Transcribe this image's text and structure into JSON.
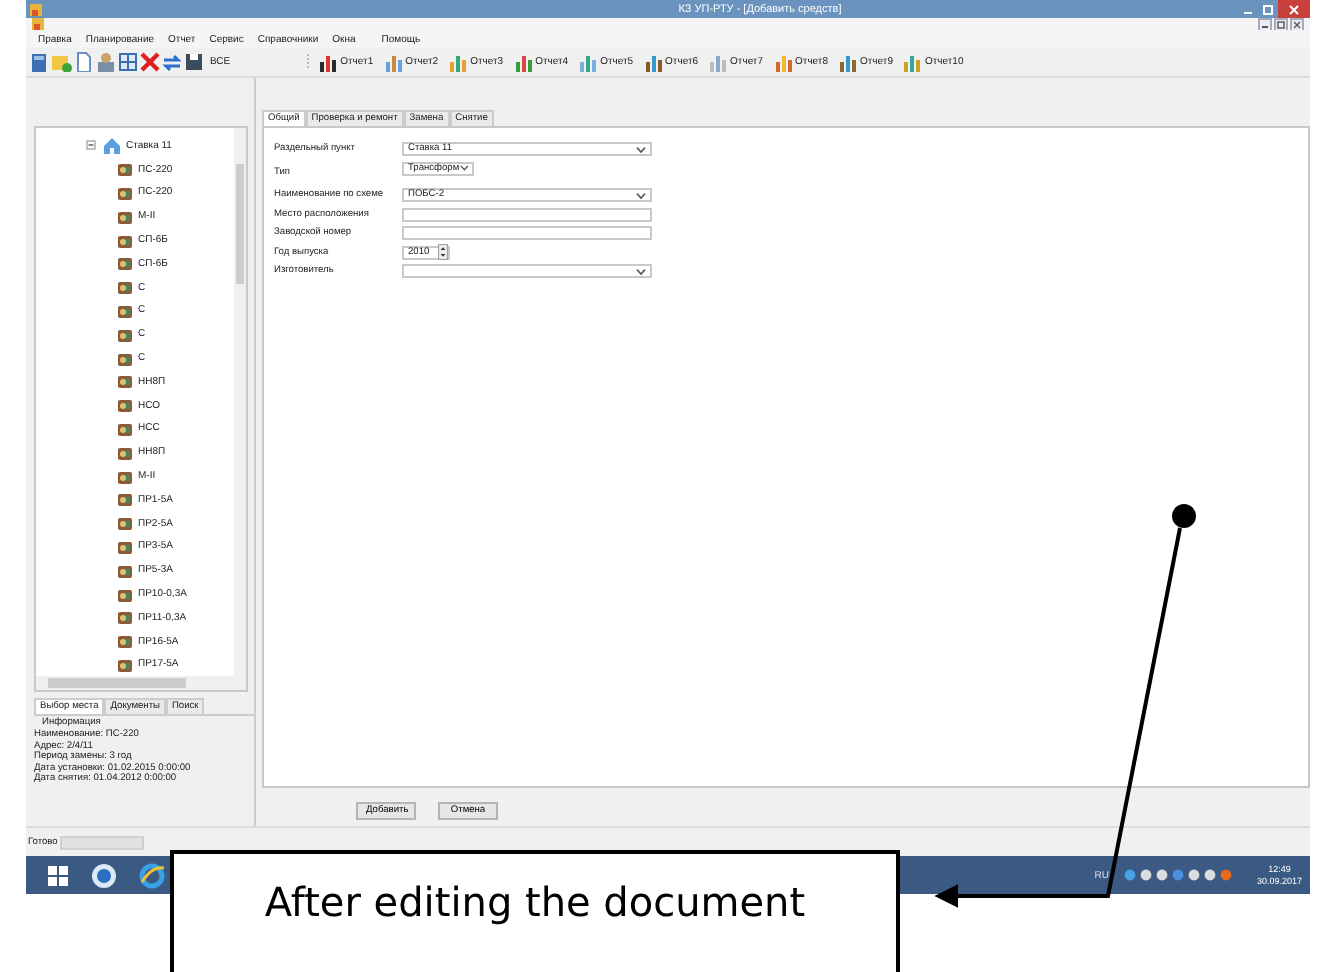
{
  "window": {
    "title": "КЗ УП-РТУ - [Добавить средств]"
  },
  "menu": [
    "Правка",
    "Планирование",
    "Отчет",
    "Сервис",
    "Справочники",
    "Окна",
    "Помощь"
  ],
  "toolbar": {
    "all_label": "ВСЕ",
    "reports": [
      "Отчет1",
      "Отчет2",
      "Отчет3",
      "Отчет4",
      "Отчет5",
      "Отчет6",
      "Отчет7",
      "Отчет8",
      "Отчет9",
      "Отчет10"
    ]
  },
  "tree": {
    "label": "Ставка 11",
    "expanded": true,
    "children": [
      {
        "label": "ПС-220"
      },
      {
        "label": "ПС-220"
      },
      {
        "label": "М-II"
      },
      {
        "label": "СП-6Б"
      },
      {
        "label": "СП-6Б"
      },
      {
        "label": "С"
      },
      {
        "label": "С"
      },
      {
        "label": "С"
      },
      {
        "label": "С"
      },
      {
        "label": "НН8П"
      },
      {
        "label": "НСО"
      },
      {
        "label": "НСС"
      },
      {
        "label": "НН8П"
      },
      {
        "label": "М-II"
      },
      {
        "label": "ПР1-5А"
      },
      {
        "label": "ПР2-5А"
      },
      {
        "label": "ПР3-5А"
      },
      {
        "label": "ПР5-3А"
      },
      {
        "label": "ПР10-0,3А"
      },
      {
        "label": "ПР11-0,3А"
      },
      {
        "label": "ПР16-5А"
      },
      {
        "label": "ПР17-5А"
      }
    ]
  },
  "left_tabs": [
    {
      "label": "Выбор места",
      "selected": true
    },
    {
      "label": "Документы",
      "selected": false
    },
    {
      "label": "Поиск",
      "selected": false
    }
  ],
  "info": {
    "heading": "Информация",
    "lines": [
      "Наименование: ПС-220",
      "Адрес: 2/4/11",
      "Период замены: 3 год",
      "Дата установки: 01.02.2015 0:00:00",
      "Дата снятия: 01.04.2012 0:00:00"
    ]
  },
  "form_tabs": [
    {
      "label": "Общий",
      "selected": true
    },
    {
      "label": "Проверка и ремонт",
      "selected": false
    },
    {
      "label": "Замена",
      "selected": false
    },
    {
      "label": "Снятие",
      "selected": false
    }
  ],
  "fields": [
    {
      "label": "Раздельный пункт",
      "kind": "combo",
      "value": "Ставка 11"
    },
    {
      "label": "Тип",
      "kind": "select",
      "value": "Трансформ"
    },
    {
      "label": "Наименование по схеме",
      "kind": "combo",
      "value": "ПОБС-2"
    },
    {
      "label": "Место расположения",
      "kind": "text"
    },
    {
      "label": "Заводской номер",
      "kind": "text"
    },
    {
      "label": "Год выпуска",
      "kind": "spin",
      "value": "2010"
    },
    {
      "label": "Изготовитель",
      "kind": "combo"
    }
  ],
  "buttons": [
    "Добавить",
    "Отмена"
  ],
  "status_bar": {
    "text": "Готово",
    "progress": {
      "level": 0
    }
  },
  "taskbar": {
    "language": "RU",
    "time": "12:49",
    "date": "30.09.2017"
  },
  "annotation": {
    "text": "After editing the document"
  }
}
